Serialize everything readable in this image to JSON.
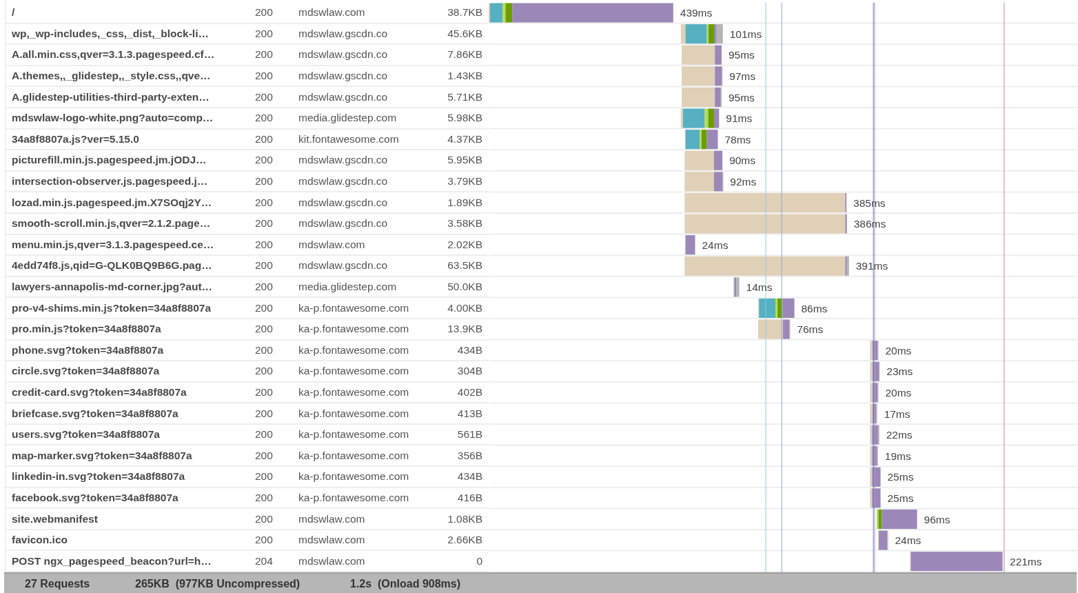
{
  "requests": [
    {
      "name": "/",
      "status": "200",
      "domain": "mdswlaw.com",
      "size": "38.7KB",
      "duration": "439ms"
    },
    {
      "name": "wp,_wp-includes,_css,_dist,_block-li…",
      "status": "200",
      "domain": "mdswlaw.gscdn.co",
      "size": "45.6KB",
      "duration": "101ms"
    },
    {
      "name": "A.all.min.css,qver=3.1.3.pagespeed.cf…",
      "status": "200",
      "domain": "mdswlaw.gscdn.co",
      "size": "7.86KB",
      "duration": "95ms"
    },
    {
      "name": "A.themes,,_glidestep,,_style.css,,qve…",
      "status": "200",
      "domain": "mdswlaw.gscdn.co",
      "size": "1.43KB",
      "duration": "97ms"
    },
    {
      "name": "A.glidestep-utilities-third-party-exten…",
      "status": "200",
      "domain": "mdswlaw.gscdn.co",
      "size": "5.71KB",
      "duration": "95ms"
    },
    {
      "name": "mdswlaw-logo-white.png?auto=comp…",
      "status": "200",
      "domain": "media.glidestep.com",
      "size": "5.98KB",
      "duration": "91ms"
    },
    {
      "name": "34a8f8807a.js?ver=5.15.0",
      "status": "200",
      "domain": "kit.fontawesome.com",
      "size": "4.37KB",
      "duration": "78ms"
    },
    {
      "name": "picturefill.min.js.pagespeed.jm.jODJ…",
      "status": "200",
      "domain": "mdswlaw.gscdn.co",
      "size": "5.95KB",
      "duration": "90ms"
    },
    {
      "name": "intersection-observer.js.pagespeed.j…",
      "status": "200",
      "domain": "mdswlaw.gscdn.co",
      "size": "3.79KB",
      "duration": "92ms"
    },
    {
      "name": "lozad.min.js.pagespeed.jm.X7SOqj2Y…",
      "status": "200",
      "domain": "mdswlaw.gscdn.co",
      "size": "1.89KB",
      "duration": "385ms"
    },
    {
      "name": "smooth-scroll.min.js,qver=2.1.2.page…",
      "status": "200",
      "domain": "mdswlaw.gscdn.co",
      "size": "3.58KB",
      "duration": "386ms"
    },
    {
      "name": "menu.min.js,qver=3.1.3.pagespeed.ce…",
      "status": "200",
      "domain": "mdswlaw.com",
      "size": "2.02KB",
      "duration": "24ms"
    },
    {
      "name": "4edd74f8.js,qid=G-QLK0BQ9B6G.pag…",
      "status": "200",
      "domain": "mdswlaw.gscdn.co",
      "size": "63.5KB",
      "duration": "391ms"
    },
    {
      "name": "lawyers-annapolis-md-corner.jpg?aut…",
      "status": "200",
      "domain": "media.glidestep.com",
      "size": "50.0KB",
      "duration": "14ms"
    },
    {
      "name": "pro-v4-shims.min.js?token=34a8f8807a",
      "status": "200",
      "domain": "ka-p.fontawesome.com",
      "size": "4.00KB",
      "duration": "86ms"
    },
    {
      "name": "pro.min.js?token=34a8f8807a",
      "status": "200",
      "domain": "ka-p.fontawesome.com",
      "size": "13.9KB",
      "duration": "76ms"
    },
    {
      "name": "phone.svg?token=34a8f8807a",
      "status": "200",
      "domain": "ka-p.fontawesome.com",
      "size": "434B",
      "duration": "20ms"
    },
    {
      "name": "circle.svg?token=34a8f8807a",
      "status": "200",
      "domain": "ka-p.fontawesome.com",
      "size": "304B",
      "duration": "23ms"
    },
    {
      "name": "credit-card.svg?token=34a8f8807a",
      "status": "200",
      "domain": "ka-p.fontawesome.com",
      "size": "402B",
      "duration": "20ms"
    },
    {
      "name": "briefcase.svg?token=34a8f8807a",
      "status": "200",
      "domain": "ka-p.fontawesome.com",
      "size": "413B",
      "duration": "17ms"
    },
    {
      "name": "users.svg?token=34a8f8807a",
      "status": "200",
      "domain": "ka-p.fontawesome.com",
      "size": "561B",
      "duration": "22ms"
    },
    {
      "name": "map-marker.svg?token=34a8f8807a",
      "status": "200",
      "domain": "ka-p.fontawesome.com",
      "size": "356B",
      "duration": "19ms"
    },
    {
      "name": "linkedin-in.svg?token=34a8f8807a",
      "status": "200",
      "domain": "ka-p.fontawesome.com",
      "size": "434B",
      "duration": "25ms"
    },
    {
      "name": "facebook.svg?token=34a8f8807a",
      "status": "200",
      "domain": "ka-p.fontawesome.com",
      "size": "416B",
      "duration": "25ms"
    },
    {
      "name": "site.webmanifest",
      "status": "200",
      "domain": "mdswlaw.com",
      "size": "1.08KB",
      "duration": "96ms"
    },
    {
      "name": "favicon.ico",
      "status": "200",
      "domain": "mdswlaw.com",
      "size": "2.66KB",
      "duration": "24ms"
    },
    {
      "name": "POST ngx_pagespeed_beacon?url=h…",
      "status": "204",
      "domain": "mdswlaw.com",
      "size": "0",
      "duration": "221ms"
    }
  ],
  "summary": [
    "27 Requests",
    "265KB  (977KB Uncompressed)",
    "1.2s  (Onload 908ms)"
  ]
}
